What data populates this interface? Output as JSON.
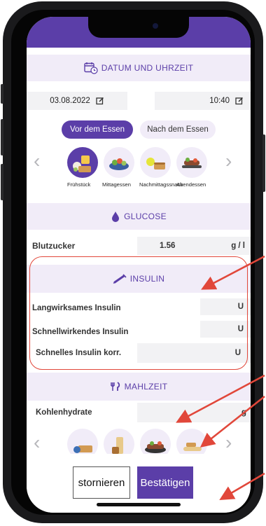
{
  "sections": {
    "datetime": "DATUM UND UHRZEIT",
    "glucose": "GLUCOSE",
    "insulin": "INSULIN",
    "meal": "MAHLZEIT"
  },
  "datetime": {
    "date": "03.08.2022",
    "time": "10:40"
  },
  "timing_tabs": [
    {
      "label": "Vor dem Essen",
      "active": true
    },
    {
      "label": "Nach dem Essen",
      "active": false
    }
  ],
  "meals": [
    {
      "label": "Frühstück",
      "icon": "breakfast-icon",
      "selected": true
    },
    {
      "label": "Mittagessen",
      "icon": "lunch-icon",
      "selected": false
    },
    {
      "label": "Nachmittagssnack",
      "icon": "snack-icon",
      "selected": false
    },
    {
      "label": "Abendessen",
      "icon": "dinner-icon",
      "selected": false
    }
  ],
  "glucose": {
    "label": "Blutzucker",
    "value": "1.56",
    "unit": "g / l"
  },
  "insulin_rows": [
    {
      "label": "Langwirksames Insulin",
      "unit": "U"
    },
    {
      "label": "Schnellwirkendes Insulin",
      "unit": "U"
    },
    {
      "label": "Schnelles Insulin korr.",
      "unit": "U"
    }
  ],
  "carbs": {
    "label": "Kohlenhydrate",
    "unit": "g"
  },
  "buttons": {
    "cancel": "stornieren",
    "confirm": "Bestätigen"
  },
  "colors": {
    "accent": "#5b3ea8",
    "accent_light": "#f1ecf8",
    "annotation": "#e1473a"
  }
}
